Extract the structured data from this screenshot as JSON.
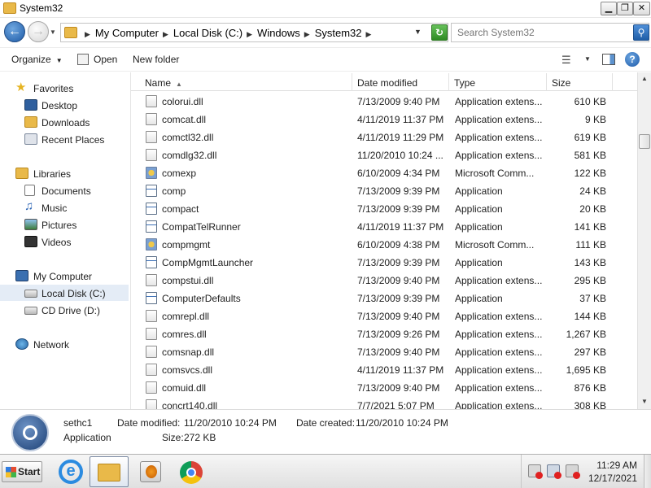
{
  "window": {
    "title": "System32",
    "minimize_symbol": "▁",
    "maximize_symbol": "❐",
    "close_symbol": "✕"
  },
  "address": {
    "crumbs": [
      "My Computer",
      "Local Disk (C:)",
      "Windows",
      "System32"
    ],
    "search_placeholder": "Search System32"
  },
  "toolbar": {
    "organize_label": "Organize",
    "open_label": "Open",
    "new_folder_label": "New folder"
  },
  "nav": {
    "favorites_label": "Favorites",
    "desktop_label": "Desktop",
    "downloads_label": "Downloads",
    "recent_label": "Recent Places",
    "libraries_label": "Libraries",
    "documents_label": "Documents",
    "music_label": "Music",
    "pictures_label": "Pictures",
    "videos_label": "Videos",
    "computer_label": "My Computer",
    "localdisk_label": "Local Disk (C:)",
    "cddrive_label": "CD Drive (D:)",
    "network_label": "Network"
  },
  "columns": {
    "name": "Name",
    "date": "Date modified",
    "type": "Type",
    "size": "Size"
  },
  "files": [
    {
      "name": "colorui.dll",
      "date": "7/13/2009 9:40 PM",
      "type": "Application extens...",
      "size": "610 KB",
      "icon": "dll-icon"
    },
    {
      "name": "comcat.dll",
      "date": "4/11/2019 11:37 PM",
      "type": "Application extens...",
      "size": "9 KB",
      "icon": "dll-icon"
    },
    {
      "name": "comctl32.dll",
      "date": "4/11/2019 11:29 PM",
      "type": "Application extens...",
      "size": "619 KB",
      "icon": "dll-icon"
    },
    {
      "name": "comdlg32.dll",
      "date": "11/20/2010 10:24 ...",
      "type": "Application extens...",
      "size": "581 KB",
      "icon": "dll-icon"
    },
    {
      "name": "comexp",
      "date": "6/10/2009 4:34 PM",
      "type": "Microsoft Comm...",
      "size": "122 KB",
      "icon": "msc-icon"
    },
    {
      "name": "comp",
      "date": "7/13/2009 9:39 PM",
      "type": "Application",
      "size": "24 KB",
      "icon": "exe-icon"
    },
    {
      "name": "compact",
      "date": "7/13/2009 9:39 PM",
      "type": "Application",
      "size": "20 KB",
      "icon": "exe-icon"
    },
    {
      "name": "CompatTelRunner",
      "date": "4/11/2019 11:37 PM",
      "type": "Application",
      "size": "141 KB",
      "icon": "exe-icon"
    },
    {
      "name": "compmgmt",
      "date": "6/10/2009 4:38 PM",
      "type": "Microsoft Comm...",
      "size": "111 KB",
      "icon": "msc-icon"
    },
    {
      "name": "CompMgmtLauncher",
      "date": "7/13/2009 9:39 PM",
      "type": "Application",
      "size": "143 KB",
      "icon": "exe-icon"
    },
    {
      "name": "compstui.dll",
      "date": "7/13/2009 9:40 PM",
      "type": "Application extens...",
      "size": "295 KB",
      "icon": "dll-icon"
    },
    {
      "name": "ComputerDefaults",
      "date": "7/13/2009 9:39 PM",
      "type": "Application",
      "size": "37 KB",
      "icon": "exe-icon"
    },
    {
      "name": "comrepl.dll",
      "date": "7/13/2009 9:40 PM",
      "type": "Application extens...",
      "size": "144 KB",
      "icon": "dll-icon"
    },
    {
      "name": "comres.dll",
      "date": "7/13/2009 9:26 PM",
      "type": "Application extens...",
      "size": "1,267 KB",
      "icon": "dll-icon"
    },
    {
      "name": "comsnap.dll",
      "date": "7/13/2009 9:40 PM",
      "type": "Application extens...",
      "size": "297 KB",
      "icon": "dll-icon"
    },
    {
      "name": "comsvcs.dll",
      "date": "4/11/2019 11:37 PM",
      "type": "Application extens...",
      "size": "1,695 KB",
      "icon": "dll-icon"
    },
    {
      "name": "comuid.dll",
      "date": "7/13/2009 9:40 PM",
      "type": "Application extens...",
      "size": "876 KB",
      "icon": "dll-icon"
    },
    {
      "name": "concrt140.dll",
      "date": "7/7/2021 5:07 PM",
      "type": "Application extens...",
      "size": "308 KB",
      "icon": "dll-icon"
    }
  ],
  "details": {
    "name": "sethc1",
    "type": "Application",
    "modified_label": "Date modified:",
    "modified_value": "11/20/2010 10:24 PM",
    "created_label": "Date created:",
    "created_value": "11/20/2010 10:24 PM",
    "size_label": "Size:",
    "size_value": "272 KB"
  },
  "taskbar": {
    "start_label": "Start",
    "time": "11:29 AM",
    "date": "12/17/2021"
  }
}
